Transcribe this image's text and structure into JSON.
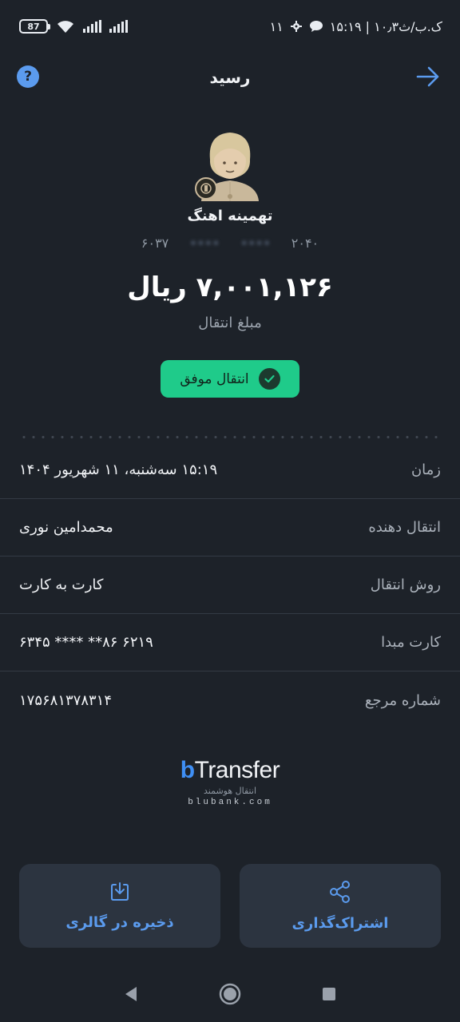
{
  "status_bar": {
    "battery": "87",
    "right_text": "۱۵:۱۹ | ۱۰٫۳ک.ب/ث",
    "notifications_count": "۱۱"
  },
  "header": {
    "title": "رسید",
    "help_symbol": "?"
  },
  "recipient": {
    "name": "تهمینه اهنگ",
    "card_start": "۶۰۳۷",
    "card_hidden_1": "••••",
    "card_hidden_2": "••••",
    "card_end": "۲۰۴۰"
  },
  "amount": {
    "value": "۷,۰۰۱,۱۲۶ ریال",
    "label": "مبلغ انتقال"
  },
  "status": {
    "text": "انتقال موفق",
    "color": "#1fcb8a"
  },
  "details": [
    {
      "label": "زمان",
      "value": "۱۵:۱۹ سه‌شنبه، ۱۱ شهریور ۱۴۰۴"
    },
    {
      "label": "انتقال دهنده",
      "value": "محمدامین نوری"
    },
    {
      "label": "روش انتقال",
      "value": "کارت به کارت"
    },
    {
      "label": "کارت مبدا",
      "value": "۶۳۴۵ **** **۸۶ ۶۲۱۹"
    },
    {
      "label": "شماره مرجع",
      "value": "۱۷۵۶۸۱۳۷۸۳۱۴"
    }
  ],
  "brand": {
    "logo_letter": "b",
    "logo_rest": "Transfer",
    "subtitle": "انتقال هوشمند",
    "url": "blubank.com"
  },
  "actions": {
    "save_label": "ذخیره در گالری",
    "share_label": "اشتراک‌گذاری"
  },
  "colors": {
    "background": "#1d2229",
    "accent": "#5b9bee",
    "success": "#1fcb8a"
  }
}
